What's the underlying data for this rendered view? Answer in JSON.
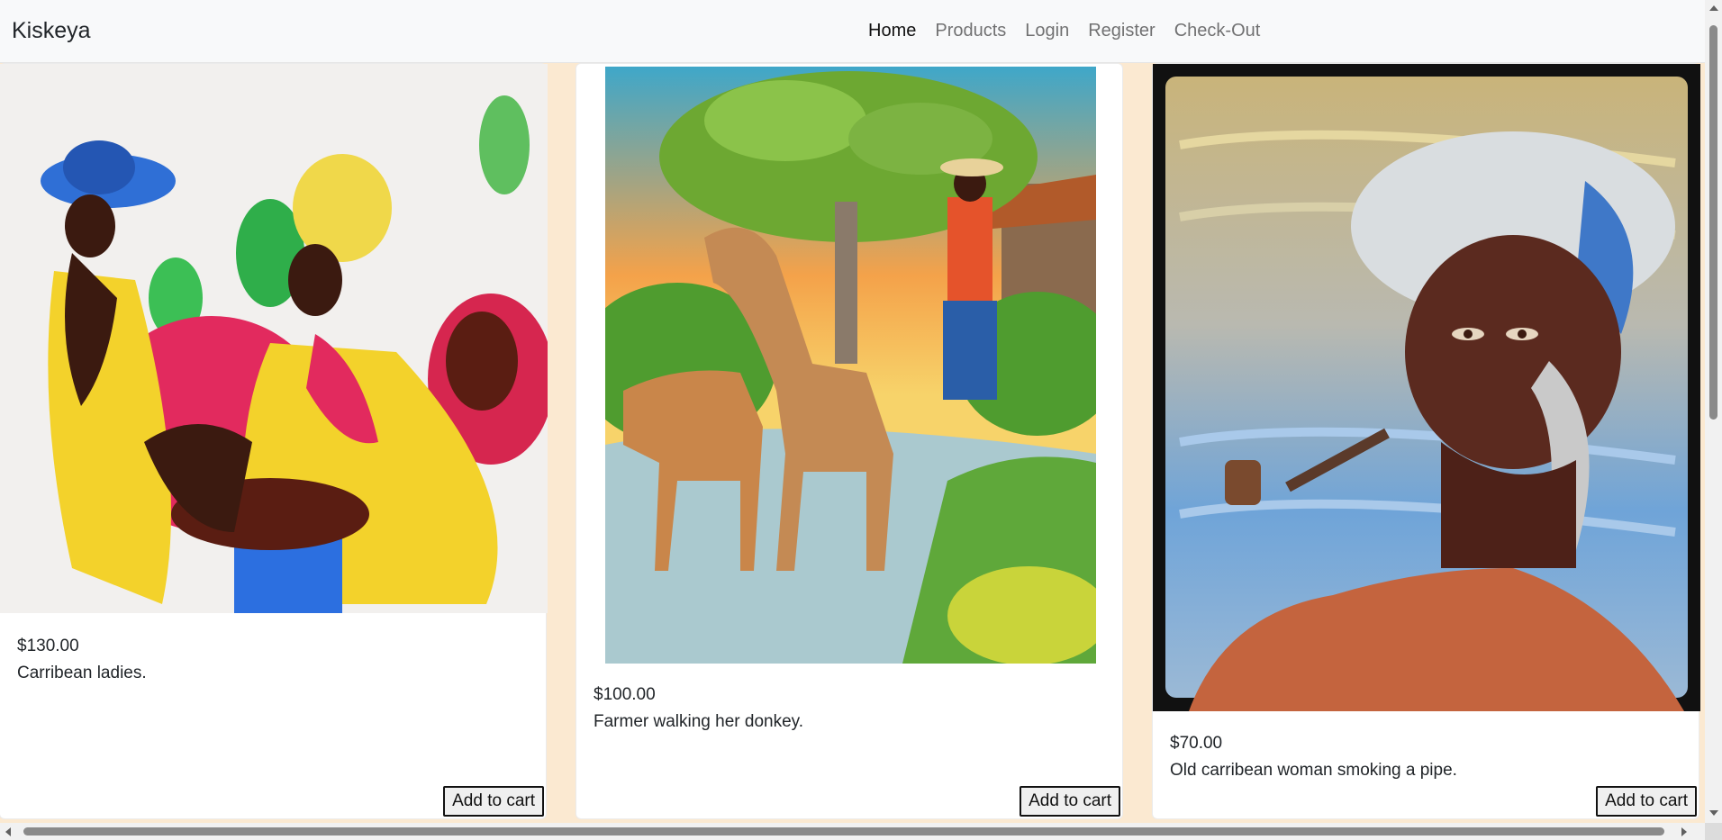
{
  "navbar": {
    "brand": "Kiskeya",
    "links": [
      "Home",
      "Products",
      "Login",
      "Register",
      "Check-Out"
    ]
  },
  "products": [
    {
      "price": "$130.00",
      "description": "Carribean ladies.",
      "button": "Add to cart"
    },
    {
      "price": "$100.00",
      "description": "Farmer walking her donkey.",
      "button": "Add to cart"
    },
    {
      "price": "$70.00",
      "description": "Old carribean woman smoking a pipe.",
      "button": "Add to cart"
    }
  ],
  "colors": {
    "page_background": "#fbe9d1",
    "navbar_background": "#f8f9fa"
  }
}
